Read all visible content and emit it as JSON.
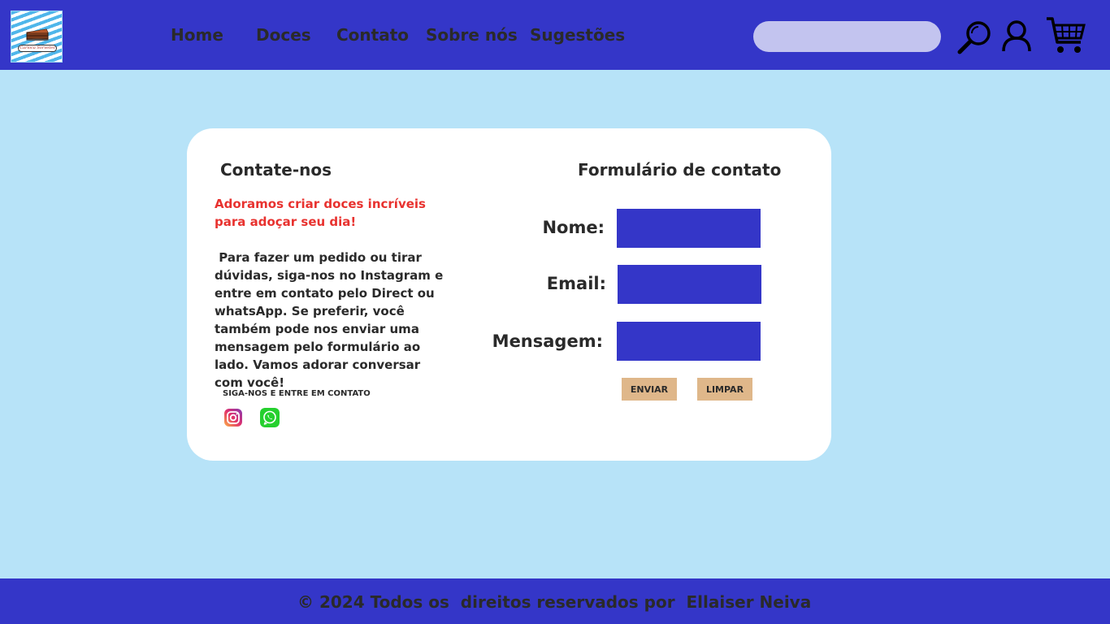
{
  "header": {
    "logo_text": "Carioca Sorvetes",
    "nav": [
      "Home",
      "Doces",
      "Contato",
      "Sobre nós",
      "Sugestões"
    ],
    "search_placeholder": "",
    "icons": [
      "search-icon",
      "user-icon",
      "cart-icon"
    ]
  },
  "contact": {
    "title": "Contate-nos",
    "highlight": "Adoramos criar doces incríveis para adoçar seu dia!",
    "body": " Para fazer um pedido ou tirar dúvidas, siga-nos no Instagram e entre em contato pelo Direct ou whatsApp. Se preferir, você também pode nos enviar uma mensagem pelo formulário ao lado. Vamos adorar conversar com você!",
    "follow_label": "SIGA-NOS E ENTRE EM CONTATO",
    "social": [
      "instagram-icon",
      "whatsapp-icon"
    ]
  },
  "form": {
    "title": "Formulário de contato",
    "name_label": "Nome:",
    "email_label": "Email:",
    "message_label": "Mensagem:",
    "name_value": "",
    "email_value": "",
    "message_value": "",
    "submit_label": "ENVIAR",
    "clear_label": "LIMPAR"
  },
  "footer": {
    "text": "© 2024 Todos os  direitos reservados por  Ellaiser Neiva"
  },
  "colors": {
    "background": "#b7e3f8",
    "header": "#3436c8",
    "card": "#ffffff",
    "highlight": "#e8322f",
    "button": "#dfb78a",
    "search": "#c3c4ef"
  }
}
